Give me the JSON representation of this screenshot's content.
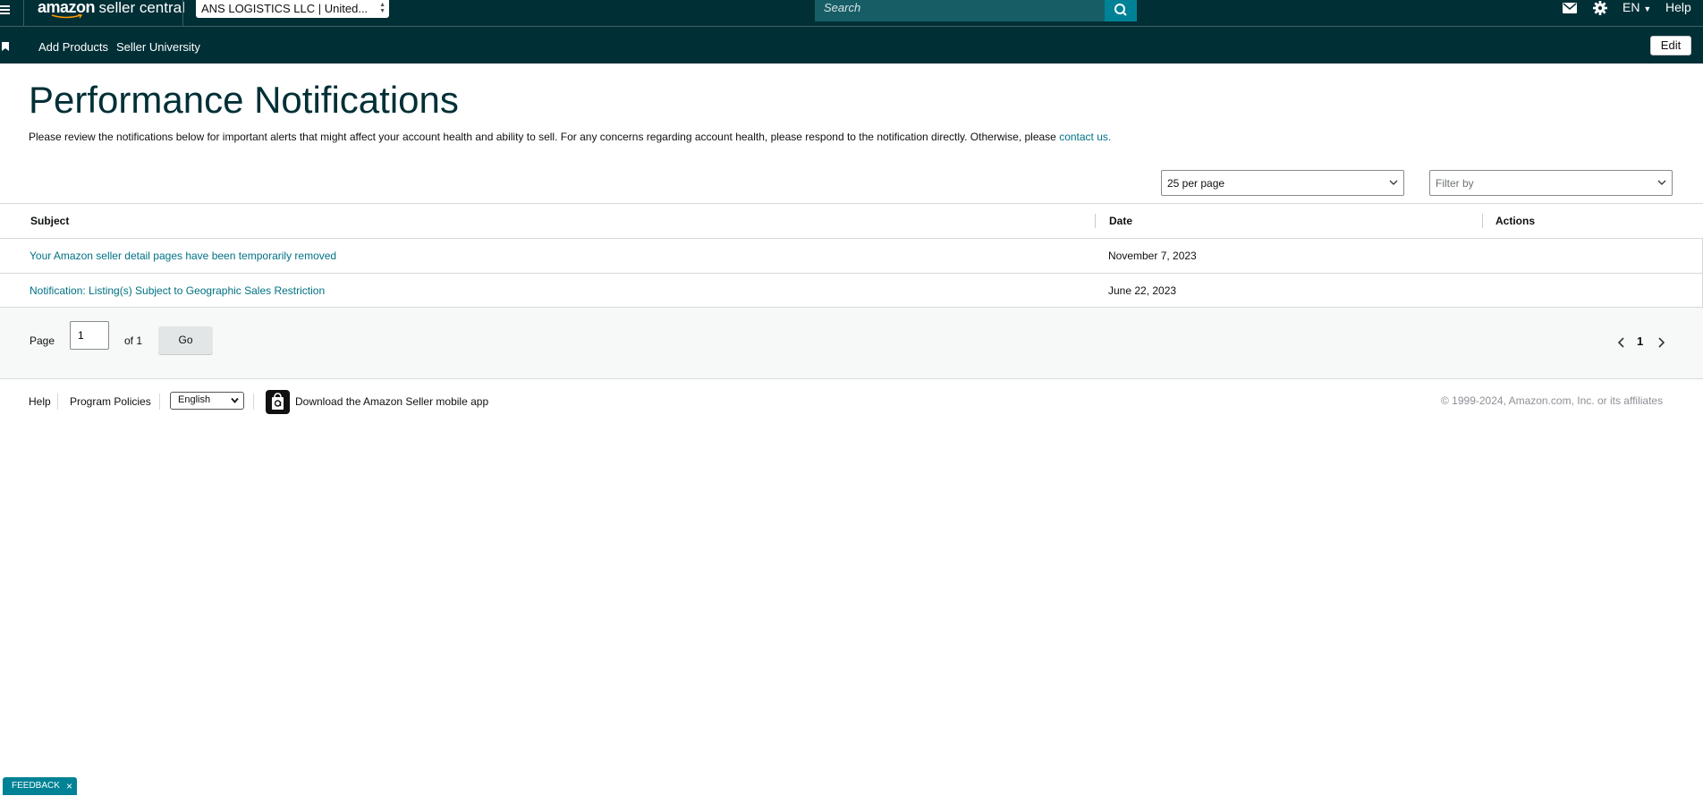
{
  "topbar": {
    "logo_brand": "amazon",
    "logo_product": "seller central",
    "account_selector": "ANS LOGISTICS LLC | United...",
    "search_placeholder": "Search",
    "language": "EN",
    "help_label": "Help",
    "icons": [
      "menu-icon",
      "search-icon",
      "mail-icon",
      "gear-icon",
      "caret-down-icon"
    ]
  },
  "navbar": {
    "links": [
      "Add Products",
      "Seller University"
    ],
    "edit_label": "Edit"
  },
  "page": {
    "title": "Performance Notifications",
    "description": "Please review the notifications below for important alerts that might affect your account health and ability to sell. For any concerns regarding account health, please respond to the notification directly. Otherwise, please ",
    "contact_link": "contact us."
  },
  "controls": {
    "per_page": "25 per page",
    "filter_placeholder": "Filter by"
  },
  "table": {
    "headers": [
      "Subject",
      "Date",
      "Actions"
    ],
    "rows": [
      {
        "subject": "Your Amazon seller detail pages have been temporarily removed",
        "date": "November 7, 2023",
        "actions": ""
      },
      {
        "subject": "Notification: Listing(s) Subject to Geographic Sales Restriction",
        "date": "June 22, 2023",
        "actions": ""
      }
    ]
  },
  "pager": {
    "page_label": "Page",
    "current_page": "1",
    "of_label": "of 1",
    "go_label": "Go",
    "page_number": "1"
  },
  "footer": {
    "help": "Help",
    "program_policies": "Program Policies",
    "language": "English",
    "app_link": "Download the Amazon Seller mobile app",
    "copyright": "© 1999-2024, Amazon.com, Inc. or its affiliates"
  },
  "feedback": {
    "label": "FEEDBACK"
  },
  "colors": {
    "header_bg": "#002f36",
    "accent": "#008296",
    "link": "#007185",
    "search_bg": "#175d66"
  }
}
